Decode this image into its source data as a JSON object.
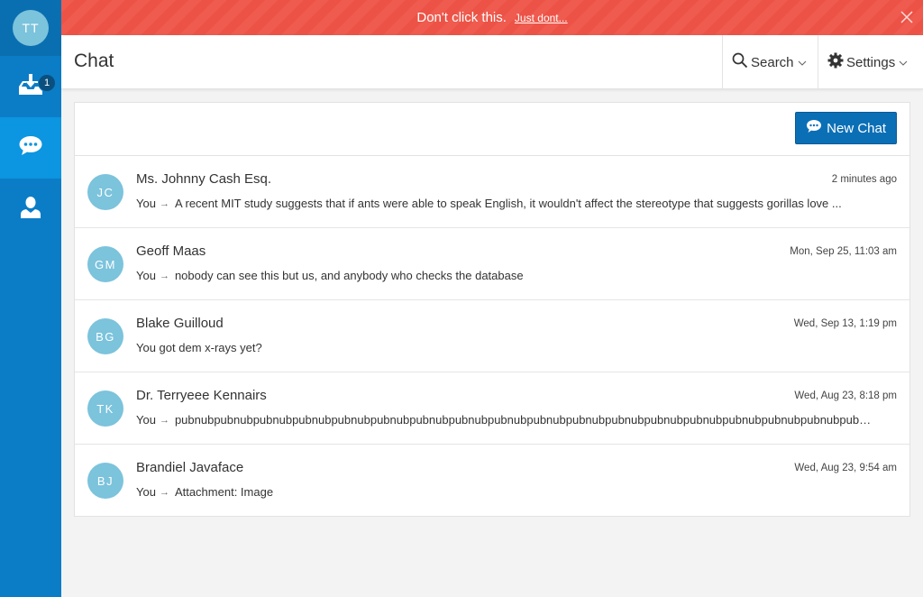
{
  "user": {
    "initials": "TT"
  },
  "sidebar": {
    "items": [
      {
        "name": "inbox",
        "icon": "inbox-download-icon",
        "badge": "1"
      },
      {
        "name": "chat",
        "icon": "chat-bubble-icon",
        "active": true
      },
      {
        "name": "profile",
        "icon": "user-icon"
      }
    ]
  },
  "alert": {
    "message": "Don't click this.",
    "link": "Just dont..."
  },
  "header": {
    "title": "Chat",
    "search_label": "Search",
    "settings_label": "Settings"
  },
  "toolbar": {
    "new_chat_label": "New Chat"
  },
  "conversations": [
    {
      "initials": "JC",
      "name": "Ms. Johnny Cash Esq.",
      "time": "2 minutes ago",
      "from": "You",
      "message": "A recent MIT study suggests that if ants were able to speak English, it wouldn't affect the stereotype that suggests gorillas love ..."
    },
    {
      "initials": "GM",
      "name": "Geoff Maas",
      "time": "Mon, Sep 25, 11:03 am",
      "from": "You",
      "message": "nobody can see this but us, and anybody who checks the database"
    },
    {
      "initials": "BG",
      "name": "Blake Guilloud",
      "time": "Wed, Sep 13, 1:19 pm",
      "from": "",
      "message": "You got dem x-rays yet?"
    },
    {
      "initials": "TK",
      "name": "Dr. Terryeee Kennairs",
      "time": "Wed, Aug 23, 8:18 pm",
      "from": "You",
      "message": "pubnubpubnubpubnubpubnubpubnubpubnubpubnubpubnubpubnubpubnubpubnubpubnubpubnubpubnubpubnubpubnubpubnubpubnubpubnubpubnu..."
    },
    {
      "initials": "BJ",
      "name": "Brandiel Javaface",
      "time": "Wed, Aug 23, 9:54 am",
      "from": "You",
      "message": "Attachment: Image"
    }
  ],
  "colors": {
    "sidebar": "#0b7dc6",
    "sidebar_active": "#0c95e0",
    "alert": "#ef5b4e",
    "primary_button": "#0b6fb6",
    "avatar": "#7cc3dc"
  }
}
